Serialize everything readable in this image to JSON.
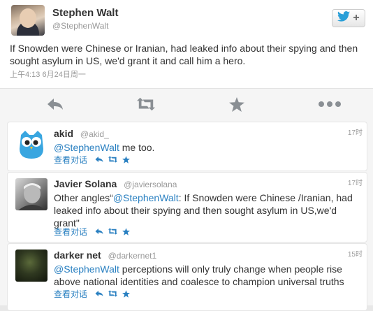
{
  "colors": {
    "link": "#2a80c1",
    "twitter_blue": "#2a9fd8",
    "icon_gray": "#8a8f94"
  },
  "main": {
    "name": "Stephen Walt",
    "handle": "@StephenWalt",
    "text": "If Snowden were Chinese or Iranian, had leaked info about their spying and then sought asylum in US, we'd grant it and call him a hero.",
    "timestamp": "上午4:13 6月24日周一",
    "follow_icon": "twitter-bird-plus-icon"
  },
  "actions": [
    "reply-icon",
    "retweet-icon",
    "favorite-icon",
    "more-icon"
  ],
  "replies": [
    {
      "name": "akid",
      "handle": "@akid_",
      "time": "17时",
      "mention": "@StephenWalt",
      "pre_text": "",
      "text": " me too.",
      "view_label": "查看对话"
    },
    {
      "name": "Javier Solana",
      "handle": "@javiersolana",
      "time": "17时",
      "pre_text": "Other angles“",
      "mention": "@StephenWalt",
      "text": ": If Snowden were Chinese /Iranian, had leaked info about their spying and then sought asylum in US,we'd grant\"",
      "view_label": "查看对话"
    },
    {
      "name": "darker net",
      "handle": "@darkernet1",
      "time": "15时",
      "pre_text": "",
      "mention": "@StephenWalt",
      "text": " perceptions will only truly change when people rise above national identities and coalesce to champion universal truths",
      "view_label": "查看对话"
    }
  ]
}
